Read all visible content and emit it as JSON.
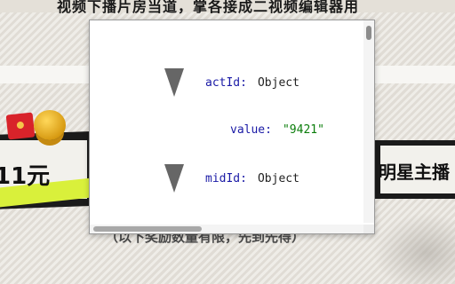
{
  "background": {
    "top_text": "视频下播片房当道，掌各接成二视频编辑器用",
    "left_card_text": "11元",
    "right_card_text": "明星主播",
    "bottom_text": "（以下奖励数量有限，先到先得）"
  },
  "popup": {
    "rows": [
      {
        "key": "actId",
        "type": "Object"
      },
      {
        "key": "value",
        "value": "\"9421\""
      },
      {
        "key": "midId",
        "type": "Object"
      }
    ],
    "colors": {
      "key": "#1a1aa6",
      "string": "#0a7d0a",
      "triangle": "#666666"
    }
  }
}
